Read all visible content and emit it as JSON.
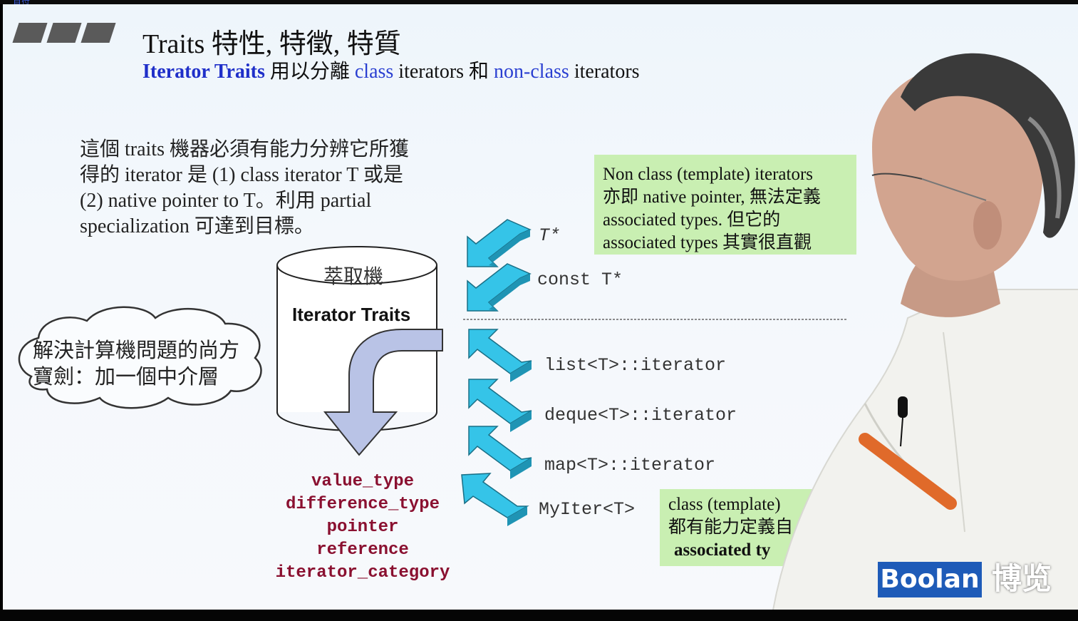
{
  "header": {
    "top_text": "首符"
  },
  "slide": {
    "title": "Traits   特性, 特徵, 特質",
    "subtitle": {
      "part1": "Iterator Traits",
      "part2": " 用以分離 ",
      "part3": "class",
      "part4": " iterators 和 ",
      "part5": "non-class",
      "part6": " iterators"
    },
    "paragraph": [
      "這個 traits 機器必須有能力分辨它所獲",
      "得的 iterator 是 (1) class iterator T 或是",
      "(2) native pointer to T。利用 partial",
      "specialization 可達到目標。"
    ],
    "cloud": [
      "解決計算機問題的尚方",
      "寶劍：加一個中介層"
    ],
    "cylinder": {
      "top_label": "萃取機",
      "label": "Iterator Traits"
    },
    "traits_list": [
      "value_type",
      "difference_type",
      "pointer",
      "reference",
      "iterator_category"
    ],
    "pointer_types": [
      "T*",
      "const  T*"
    ],
    "class_iterators": [
      "list<T>::iterator",
      "deque<T>::iterator",
      "map<T>::iterator",
      "MyIter<T>"
    ],
    "note_nonclass": [
      "Non class (template) iterators",
      "亦即 native pointer, 無法定義",
      "associated types. 但它的",
      "associated types 其實很直觀"
    ],
    "note_class": [
      "class (template)",
      "都有能力定義自",
      "associated ty"
    ]
  },
  "brand": {
    "name": "Boolan",
    "cn": "博览",
    "color": "#1e5bb8"
  },
  "colors": {
    "arrow": "#3fc8e8",
    "note_bg": "#c9efb2",
    "traits_list": "#8a1030",
    "blue_text": "#2a3fd1"
  }
}
